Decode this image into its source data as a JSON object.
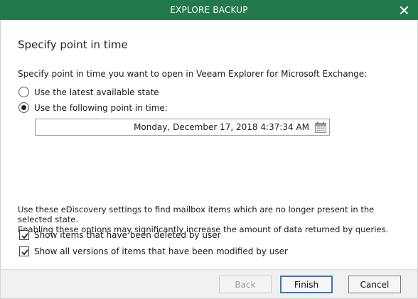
{
  "window": {
    "title": "EXPLORE BACKUP",
    "accent_color": "#22794c"
  },
  "page": {
    "heading": "Specify point in time",
    "instruction": "Specify point in time you want to open in Veeam Explorer for Microsoft Exchange:"
  },
  "options": {
    "latest_label": "Use the latest available state",
    "latest_selected": false,
    "point_label": "Use the following point in time:",
    "point_selected": true
  },
  "datetime": {
    "value": "Monday, December 17, 2018 4:37:34 AM",
    "icon": "calendar-icon"
  },
  "ediscovery": {
    "note_line1": "Use these eDiscovery settings to find mailbox items which are no longer present in the selected state.",
    "note_line2": "Enabling these options may significantly increase the amount of data returned by queries.",
    "deleted_label": "Show items that have been deleted by user",
    "deleted_checked": true,
    "versions_label": "Show all versions of items that have been modified by user",
    "versions_checked": true
  },
  "buttons": {
    "back": "Back",
    "finish": "Finish",
    "cancel": "Cancel"
  }
}
